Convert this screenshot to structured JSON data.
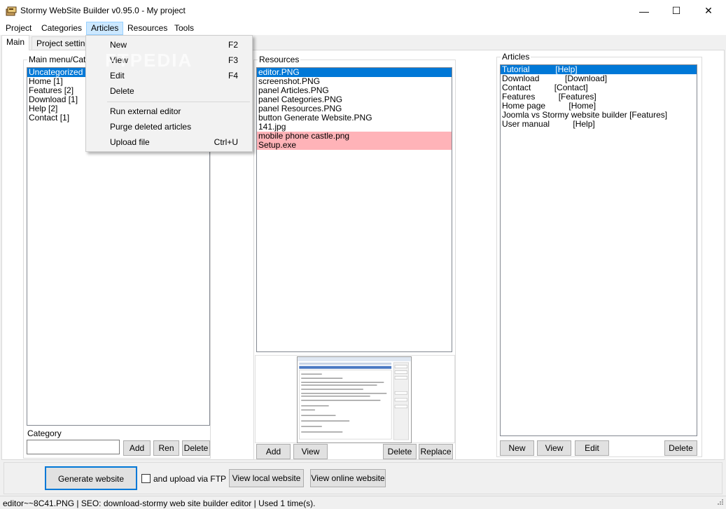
{
  "window": {
    "title": "Stormy WebSite Builder  v0.95.0 - My project",
    "min_glyph": "—",
    "max_glyph": "☐",
    "close_glyph": "✕"
  },
  "menubar": [
    "Project",
    "Categories",
    "Articles",
    "Resources",
    "Tools"
  ],
  "tabs": [
    "Main",
    "Project settings"
  ],
  "articles_menu": {
    "items": [
      {
        "label": "New",
        "shortcut": "F2"
      },
      {
        "label": "View",
        "shortcut": "F3"
      },
      {
        "label": "Edit",
        "shortcut": "F4"
      },
      {
        "label": "Delete",
        "shortcut": ""
      },
      {
        "label": "Run external editor",
        "shortcut": ""
      },
      {
        "label": "Purge deleted articles",
        "shortcut": ""
      },
      {
        "label": "Upload file",
        "shortcut": "Ctrl+U"
      }
    ]
  },
  "watermark": "FTPEDIA",
  "categories": {
    "label": "Main menu/Categ",
    "items": [
      "Uncategorized [0]",
      "Home [1]",
      "Features [2]",
      "Download [1]",
      "Help [2]",
      "Contact [1]"
    ],
    "category_label": "Category",
    "category_value": "",
    "add": "Add",
    "rename": "Ren",
    "delete": "Delete"
  },
  "resources": {
    "label": "Resources",
    "items": [
      "editor.PNG",
      "screenshot.PNG",
      "panel Articles.PNG",
      "panel Categories.PNG",
      "panel Resources.PNG",
      "button Generate Website.PNG",
      "141.jpg",
      "mobile phone castle.png",
      "Setup.exe"
    ],
    "add": "Add",
    "view": "View",
    "delete": "Delete",
    "replace": "Replace"
  },
  "articles": {
    "label": "Articles",
    "items": [
      "Tutorial           [Help]",
      "Download           [Download]",
      "Contact          [Contact]",
      "Features          [Features]",
      "Home page          [Home]",
      "Joomla vs Stormy website builder [Features]",
      "User manual          [Help]"
    ],
    "new": "New",
    "view": "View",
    "edit": "Edit",
    "delete": "Delete"
  },
  "bottom": {
    "generate": "Generate website",
    "ftp_label": "and upload via FTP",
    "view_local": "View local website",
    "view_online": "View online website"
  },
  "status": "editor~~8C41.PNG | SEO: download-stormy web site builder editor | Used 1 time(s).",
  "colors": {
    "selection": "#0078d7",
    "highlight_row": "#ffb3b8",
    "menu_active": "#cce8ff"
  }
}
